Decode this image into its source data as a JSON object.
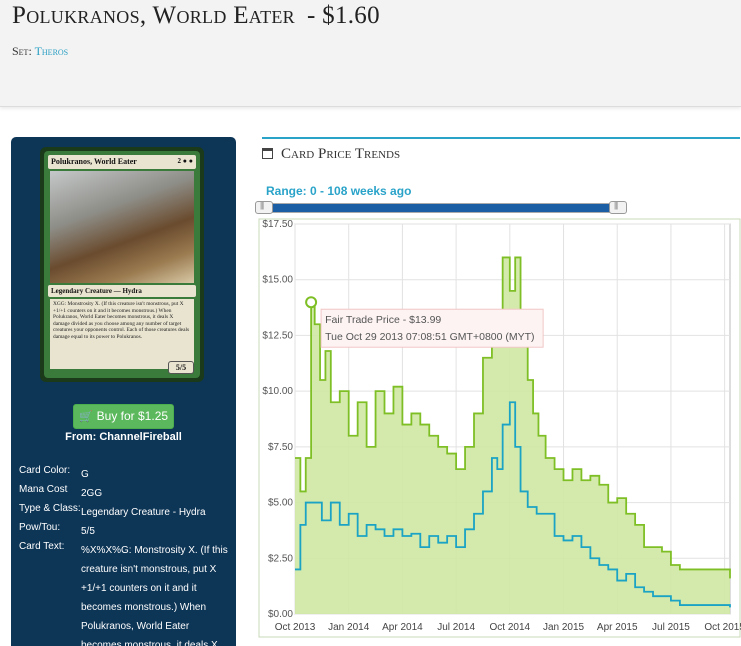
{
  "header": {
    "card_name": "Polukranos, World Eater",
    "price": "- $1.60",
    "set_label": "Set:",
    "set_name": "Theros"
  },
  "card_image": {
    "name": "Polukranos, World Eater",
    "mana": "2 ● ●",
    "type_line": "Legendary Creature — Hydra",
    "text": "XGG: Monstrosity X. (If this creature isn't monstrous, put X +1/+1 counters on it and it becomes monstrous.) When Polukranos, World Eater becomes monstrous, it deals X damage divided as you choose among any number of target creatures your opponents control. Each of those creatures deals damage equal to its power to Polukranos.",
    "pt": "5/5"
  },
  "buy": {
    "label": "Buy for $1.25",
    "from": "From: ChannelFireball"
  },
  "details": [
    {
      "label": "Card Color:",
      "value": "G"
    },
    {
      "label": "Mana Cost",
      "value": "2GG"
    },
    {
      "label": "Type & Class:",
      "value": "Legendary Creature - Hydra"
    },
    {
      "label": "Pow/Tou:",
      "value": "5/5"
    },
    {
      "label": "Card Text:",
      "value": "%X%X%G: Monstrosity X. (If this creature isn't monstrous, put X +1/+1 counters on it and it becomes monstrous.) When Polukranos, World Eater becomes monstrous, it deals X"
    }
  ],
  "chart_section": {
    "heading": "Card Price Trends",
    "range_label": "Range: 0 - 108 weeks ago"
  },
  "colors": {
    "accent": "#2aa3c9",
    "fair_trade_line": "#7fbf26",
    "fair_trade_fill": "#cfe8a3",
    "second_line": "#1aa3c4",
    "sidebar": "#0d3556",
    "buy_button": "#5cb85c"
  },
  "chart_data": {
    "type": "line",
    "title": "",
    "xlabel": "",
    "ylabel": "",
    "ylim": [
      0,
      17.5
    ],
    "y_ticks": [
      "$0.00",
      "$2.50",
      "$5.00",
      "$7.50",
      "$10.00",
      "$12.50",
      "$15.00",
      "$17.50"
    ],
    "y_tick_values": [
      0,
      2.5,
      5,
      7.5,
      10,
      12.5,
      15,
      17.5
    ],
    "x_ticks": [
      "Oct 2013",
      "Jan 2014",
      "Apr 2014",
      "Jul 2014",
      "Oct 2014",
      "Jan 2015",
      "Apr 2015",
      "Jul 2015",
      "Oct 2015"
    ],
    "x_tick_values": [
      0,
      3,
      6,
      9,
      12,
      15,
      18,
      21,
      24
    ],
    "x_unit": "months since Oct 2013",
    "grid": true,
    "series": [
      {
        "name": "Fair Trade Price",
        "area": true,
        "points": [
          [
            0,
            7.0
          ],
          [
            0.3,
            5.5
          ],
          [
            0.6,
            7.0
          ],
          [
            0.9,
            13.99
          ],
          [
            1.1,
            13.0
          ],
          [
            1.4,
            10.5
          ],
          [
            1.7,
            11.8
          ],
          [
            2.0,
            9.5
          ],
          [
            2.5,
            10.0
          ],
          [
            3.0,
            8.0
          ],
          [
            3.5,
            9.5
          ],
          [
            4.0,
            7.5
          ],
          [
            4.5,
            10.0
          ],
          [
            5.0,
            9.0
          ],
          [
            5.5,
            10.2
          ],
          [
            6.0,
            8.5
          ],
          [
            6.5,
            9.0
          ],
          [
            7.0,
            8.5
          ],
          [
            7.5,
            8.0
          ],
          [
            8.0,
            7.5
          ],
          [
            8.5,
            7.2
          ],
          [
            9.0,
            6.5
          ],
          [
            9.5,
            7.5
          ],
          [
            10.0,
            9.0
          ],
          [
            10.5,
            11.5
          ],
          [
            11.0,
            13.5
          ],
          [
            11.3,
            13.0
          ],
          [
            11.6,
            16.0
          ],
          [
            12.0,
            14.5
          ],
          [
            12.3,
            16.0
          ],
          [
            12.6,
            12.0
          ],
          [
            13.0,
            10.5
          ],
          [
            13.3,
            9.0
          ],
          [
            13.6,
            8.0
          ],
          [
            14.0,
            7.0
          ],
          [
            14.5,
            6.5
          ],
          [
            15.0,
            6.0
          ],
          [
            15.5,
            6.5
          ],
          [
            16.0,
            6.0
          ],
          [
            16.5,
            6.2
          ],
          [
            17.0,
            5.8
          ],
          [
            17.5,
            5.0
          ],
          [
            18.0,
            5.2
          ],
          [
            18.5,
            4.5
          ],
          [
            19.0,
            4.0
          ],
          [
            19.5,
            3.0
          ],
          [
            20.0,
            3.0
          ],
          [
            20.5,
            2.8
          ],
          [
            21.0,
            2.2
          ],
          [
            21.5,
            2.0
          ],
          [
            22.5,
            2.0
          ],
          [
            23.5,
            2.0
          ],
          [
            24.3,
            1.6
          ]
        ]
      },
      {
        "name": "",
        "area": false,
        "points": [
          [
            0,
            2.0
          ],
          [
            0.3,
            4.0
          ],
          [
            0.6,
            5.0
          ],
          [
            1.0,
            5.0
          ],
          [
            1.5,
            4.2
          ],
          [
            2.0,
            5.0
          ],
          [
            2.5,
            4.0
          ],
          [
            3.0,
            4.5
          ],
          [
            3.5,
            3.5
          ],
          [
            4.0,
            4.0
          ],
          [
            4.5,
            3.8
          ],
          [
            5.0,
            3.5
          ],
          [
            5.5,
            3.8
          ],
          [
            6.0,
            3.5
          ],
          [
            6.5,
            3.6
          ],
          [
            7.0,
            3.0
          ],
          [
            7.5,
            3.5
          ],
          [
            8.0,
            3.2
          ],
          [
            8.5,
            3.5
          ],
          [
            9.0,
            3.0
          ],
          [
            9.5,
            3.8
          ],
          [
            10.0,
            4.5
          ],
          [
            10.5,
            5.5
          ],
          [
            11.0,
            7.0
          ],
          [
            11.3,
            6.5
          ],
          [
            11.6,
            8.5
          ],
          [
            12.0,
            9.5
          ],
          [
            12.3,
            7.5
          ],
          [
            12.6,
            5.5
          ],
          [
            13.0,
            4.8
          ],
          [
            13.5,
            4.5
          ],
          [
            14.0,
            4.5
          ],
          [
            14.5,
            3.5
          ],
          [
            15.0,
            3.3
          ],
          [
            15.5,
            3.5
          ],
          [
            16.0,
            3.0
          ],
          [
            16.5,
            2.5
          ],
          [
            17.0,
            2.2
          ],
          [
            17.5,
            2.0
          ],
          [
            18.0,
            1.5
          ],
          [
            18.5,
            1.8
          ],
          [
            19.0,
            1.2
          ],
          [
            19.5,
            1.0
          ],
          [
            20.0,
            0.8
          ],
          [
            21.0,
            0.6
          ],
          [
            21.5,
            0.4
          ],
          [
            22.5,
            0.4
          ],
          [
            23.5,
            0.4
          ],
          [
            24.3,
            0.3
          ]
        ]
      }
    ],
    "tooltip": {
      "title": "Fair Trade Price - $13.99",
      "subtitle": "Tue Oct 29 2013 07:08:51 GMT+0800 (MYT)",
      "x": 0.9,
      "y": 13.99
    }
  }
}
